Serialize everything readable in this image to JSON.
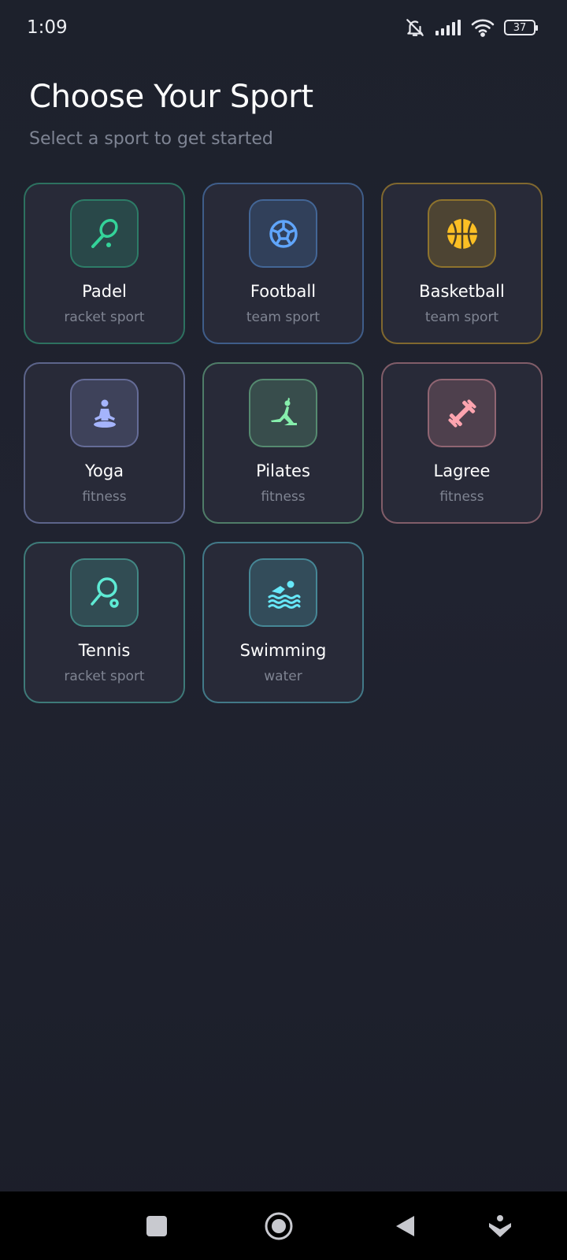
{
  "status_bar": {
    "time": "1:09",
    "battery": "37"
  },
  "header": {
    "title": "Choose Your Sport",
    "subtitle": "Select a sport to get started"
  },
  "sports": [
    {
      "name": "Padel",
      "category": "racket sport",
      "icon": "padel-racket-icon",
      "accent": "#34d399"
    },
    {
      "name": "Football",
      "category": "team sport",
      "icon": "soccer-ball-icon",
      "accent": "#60a5fa"
    },
    {
      "name": "Basketball",
      "category": "team sport",
      "icon": "basketball-icon",
      "accent": "#fbbf24"
    },
    {
      "name": "Yoga",
      "category": "fitness",
      "icon": "meditation-icon",
      "accent": "#a5b4fc"
    },
    {
      "name": "Pilates",
      "category": "fitness",
      "icon": "gymnast-icon",
      "accent": "#86efac"
    },
    {
      "name": "Lagree",
      "category": "fitness",
      "icon": "dumbbell-icon",
      "accent": "#fda4af"
    },
    {
      "name": "Tennis",
      "category": "racket sport",
      "icon": "tennis-racket-icon",
      "accent": "#5eead4"
    },
    {
      "name": "Swimming",
      "category": "water",
      "icon": "swimmer-icon",
      "accent": "#67e8f9"
    }
  ],
  "nav": {
    "recents": "square-icon",
    "home": "home-circle-icon",
    "back": "back-triangle-icon",
    "extra": "accessibility-icon"
  }
}
